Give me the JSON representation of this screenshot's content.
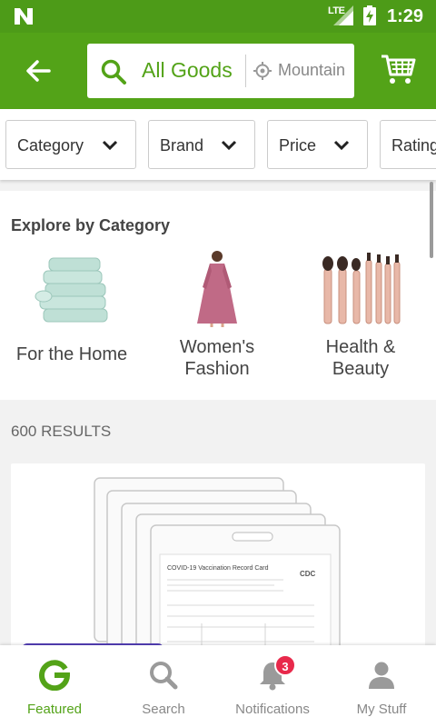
{
  "status_bar": {
    "network": "LTE",
    "time": "1:29"
  },
  "header": {
    "search_text": "All Goods",
    "location_text": "Mountain",
    "accent_color": "#53a318"
  },
  "filters": [
    {
      "label": "Category"
    },
    {
      "label": "Brand"
    },
    {
      "label": "Price"
    },
    {
      "label": "Rating"
    }
  ],
  "explore": {
    "title": "Explore by Category",
    "categories": [
      {
        "line1": "For the Home",
        "line2": ""
      },
      {
        "line1": "Women's",
        "line2": "Fashion"
      },
      {
        "line1": "Health &",
        "line2": "Beauty"
      }
    ]
  },
  "results": {
    "count_label": "600 RESULTS"
  },
  "product": {
    "card_title": "COVID-19 Vaccination Record Card",
    "card_logo": "CDC"
  },
  "bottom_nav": {
    "items": [
      {
        "label": "Featured",
        "active": true
      },
      {
        "label": "Search"
      },
      {
        "label": "Notifications",
        "badge": "3"
      },
      {
        "label": "My Stuff"
      }
    ]
  }
}
